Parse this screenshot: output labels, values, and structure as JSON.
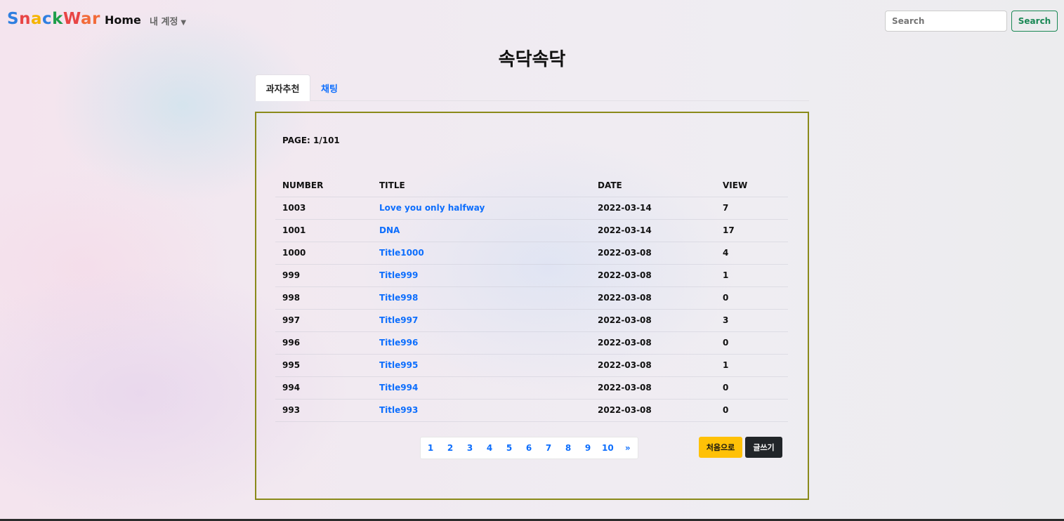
{
  "navbar": {
    "brand_letters": [
      {
        "ch": "S",
        "color": "#2f7fe0"
      },
      {
        "ch": "n",
        "color": "#e84545"
      },
      {
        "ch": "a",
        "color": "#f5b400"
      },
      {
        "ch": "c",
        "color": "#2f7fe0"
      },
      {
        "ch": "k",
        "color": "#1e9e4a"
      },
      {
        "ch": "W",
        "color": "#e84545"
      },
      {
        "ch": "a",
        "color": "#f26b3a"
      },
      {
        "ch": "r",
        "color": "#f26b3a"
      }
    ],
    "home_label": "Home",
    "account_label": "내 계정",
    "account_icon": "caret-down-icon",
    "search_placeholder": "Search",
    "search_button_label": "Search"
  },
  "page": {
    "title": "속닥속닥"
  },
  "tabs": [
    {
      "label": "과자추천",
      "active": true
    },
    {
      "label": "채팅",
      "active": false
    }
  ],
  "board": {
    "page_info": "PAGE: 1/101",
    "columns": [
      "NUMBER",
      "TITLE",
      "DATE",
      "VIEW"
    ],
    "rows": [
      {
        "number": "1003",
        "title": "Love you only halfway",
        "date": "2022-03-14",
        "view": "7"
      },
      {
        "number": "1001",
        "title": "DNA",
        "date": "2022-03-14",
        "view": "17"
      },
      {
        "number": "1000",
        "title": "Title1000",
        "date": "2022-03-08",
        "view": "4"
      },
      {
        "number": "999",
        "title": "Title999",
        "date": "2022-03-08",
        "view": "1"
      },
      {
        "number": "998",
        "title": "Title998",
        "date": "2022-03-08",
        "view": "0"
      },
      {
        "number": "997",
        "title": "Title997",
        "date": "2022-03-08",
        "view": "3"
      },
      {
        "number": "996",
        "title": "Title996",
        "date": "2022-03-08",
        "view": "0"
      },
      {
        "number": "995",
        "title": "Title995",
        "date": "2022-03-08",
        "view": "1"
      },
      {
        "number": "994",
        "title": "Title994",
        "date": "2022-03-08",
        "view": "0"
      },
      {
        "number": "993",
        "title": "Title993",
        "date": "2022-03-08",
        "view": "0"
      }
    ],
    "pagination": [
      "1",
      "2",
      "3",
      "4",
      "5",
      "6",
      "7",
      "8",
      "9",
      "10",
      "»"
    ],
    "first_button_label": "처음으로",
    "write_button_label": "글쓰기"
  },
  "colors": {
    "link": "#0d6efd",
    "search_green": "#198754",
    "board_border": "#8a8a1a",
    "first_button": "#ffc107",
    "write_button": "#212529"
  }
}
